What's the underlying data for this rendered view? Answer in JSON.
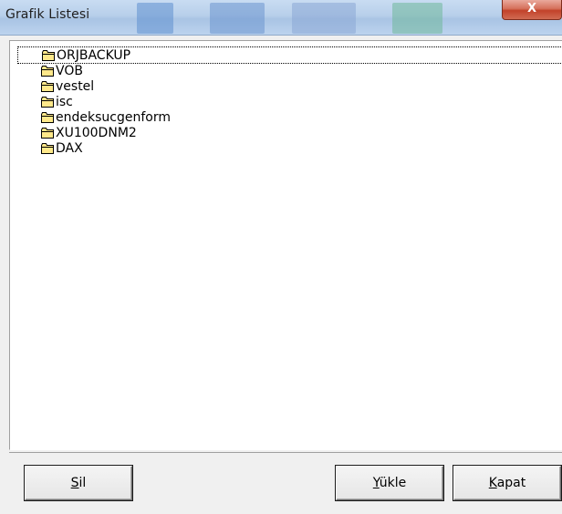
{
  "window": {
    "title": "Grafik Listesi",
    "close_glyph": "X"
  },
  "list": {
    "items": [
      {
        "label": "ORJBACKUP",
        "icon": "folder-icon",
        "focused": true
      },
      {
        "label": "VOB",
        "icon": "folder-icon"
      },
      {
        "label": "vestel",
        "icon": "folder-icon"
      },
      {
        "label": "isc",
        "icon": "folder-icon"
      },
      {
        "label": "endeksucgenform",
        "icon": "folder-icon"
      },
      {
        "label": "XU100DNM2",
        "icon": "folder-icon"
      },
      {
        "label": "DAX",
        "icon": "folder-icon"
      }
    ]
  },
  "buttons": {
    "sil": {
      "mnemonic": "S",
      "rest": "il"
    },
    "yukle": {
      "mnemonic": "Y",
      "rest": "ükle"
    },
    "kapat": {
      "mnemonic": "K",
      "rest": "apat"
    }
  },
  "colors": {
    "titlebar": "#b7cfea",
    "close": "#c2422a",
    "folder_fill": "#ffe88a",
    "folder_stroke": "#000000"
  }
}
